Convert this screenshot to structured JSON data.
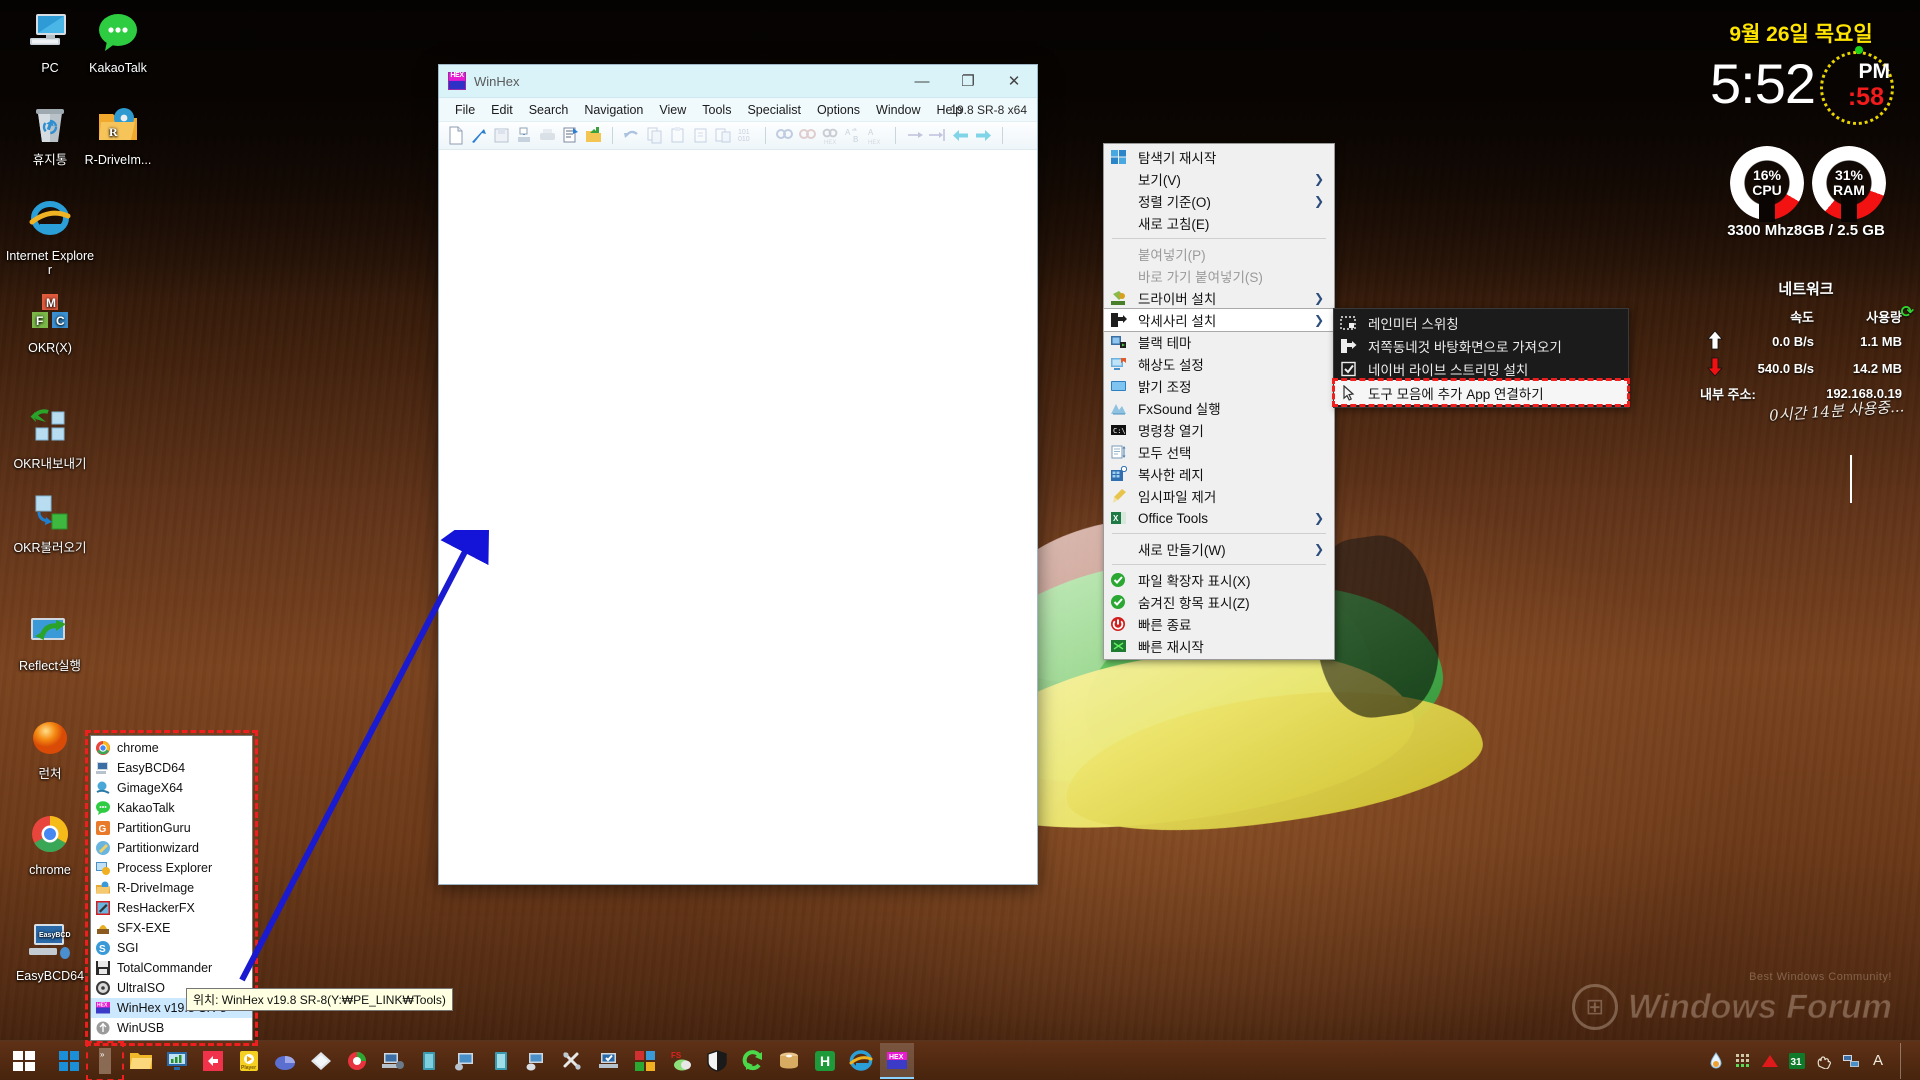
{
  "desktop": {
    "icons": [
      {
        "label": "PC",
        "icon": "computer-icon"
      },
      {
        "label": "KakaoTalk",
        "icon": "kakaotalk-icon"
      },
      {
        "label": "휴지통",
        "icon": "recycle-bin-icon"
      },
      {
        "label": "R-DriveIm...",
        "icon": "r-drive-image-icon"
      },
      {
        "label": "Internet Explorer",
        "icon": "internet-explorer-icon"
      },
      {
        "label": "OKR(X)",
        "icon": "okr-x-icon"
      },
      {
        "label": "OKR내보내기",
        "icon": "okr-export-icon"
      },
      {
        "label": "OKR불러오기",
        "icon": "okr-import-icon"
      },
      {
        "label": "Reflect실행",
        "icon": "reflect-run-icon"
      },
      {
        "label": "런처",
        "icon": "launcher-orb-icon"
      },
      {
        "label": "chrome",
        "icon": "chrome-icon"
      },
      {
        "label": "EasyBCD64",
        "icon": "easybcd-icon"
      }
    ]
  },
  "winhex": {
    "title": "WinHex",
    "app_icon": "winhex-icon",
    "version": "19.8 SR-8 x64",
    "window_buttons": {
      "minimize": "—",
      "maximize": "❐",
      "close": "✕"
    },
    "menus": [
      "File",
      "Edit",
      "Search",
      "Navigation",
      "View",
      "Tools",
      "Specialist",
      "Options",
      "Window",
      "Help"
    ],
    "toolbar_groups": [
      [
        "new-file-icon",
        "open-file-icon",
        "save-file-icon",
        "save-as-icon",
        "print-icon",
        "properties-icon",
        "open-folder-icon"
      ],
      [
        "undo-icon",
        "copy-icon",
        "paste-clipboard-icon",
        "paste-icon",
        "copy-block-icon",
        "binary-101-icon"
      ],
      [
        "find-icon",
        "find-hex-icon",
        "find-next-icon",
        "replace-text-icon",
        "replace-hex-icon"
      ],
      [
        "goto-icon",
        "goto-offset-icon",
        "back-icon",
        "forward-icon"
      ]
    ]
  },
  "context_menu": {
    "items": [
      {
        "label": "탐색기 재시작",
        "icon": "explorer-restart-icon",
        "arrow": false,
        "disabled": false,
        "selected": false
      },
      {
        "label": "보기(V)",
        "icon": "none",
        "arrow": true,
        "disabled": false,
        "selected": false
      },
      {
        "label": "정렬 기준(O)",
        "icon": "none",
        "arrow": true,
        "disabled": false,
        "selected": false
      },
      {
        "label": "새로 고침(E)",
        "icon": "none",
        "arrow": false,
        "disabled": false,
        "selected": false
      },
      {
        "separator": true
      },
      {
        "label": "붙여넣기(P)",
        "icon": "none",
        "arrow": false,
        "disabled": true,
        "selected": false
      },
      {
        "label": "바로 가기 붙여넣기(S)",
        "icon": "none",
        "arrow": false,
        "disabled": true,
        "selected": false
      },
      {
        "label": "드라이버 설치",
        "icon": "driver-install-icon",
        "arrow": true,
        "disabled": false,
        "selected": false
      },
      {
        "label": "악세사리 설치",
        "icon": "accessory-install-icon",
        "arrow": true,
        "disabled": false,
        "selected": true
      },
      {
        "label": "블랙      테마",
        "icon": "black-theme-icon",
        "arrow": false,
        "disabled": false,
        "selected": false
      },
      {
        "label": "해상도    설정",
        "icon": "resolution-icon",
        "arrow": false,
        "disabled": false,
        "selected": false
      },
      {
        "label": "밝기      조정",
        "icon": "brightness-icon",
        "arrow": false,
        "disabled": false,
        "selected": false
      },
      {
        "label": "FxSound 실행",
        "icon": "fxsound-icon",
        "arrow": false,
        "disabled": false,
        "selected": false
      },
      {
        "label": "명령창    열기",
        "icon": "command-prompt-icon",
        "arrow": false,
        "disabled": false,
        "selected": false
      },
      {
        "label": "모두      선택",
        "icon": "select-all-icon",
        "arrow": false,
        "disabled": false,
        "selected": false
      },
      {
        "label": "복사한    레지",
        "icon": "registry-copy-icon",
        "arrow": false,
        "disabled": false,
        "selected": false
      },
      {
        "label": "임시파일 제거",
        "icon": "temp-clean-icon",
        "arrow": false,
        "disabled": false,
        "selected": false
      },
      {
        "label": "Office    Tools",
        "icon": "office-tools-icon",
        "arrow": true,
        "disabled": false,
        "selected": false
      },
      {
        "separator": true
      },
      {
        "label": "새로 만들기(W)",
        "icon": "none",
        "arrow": true,
        "disabled": false,
        "selected": false
      },
      {
        "separator": true
      },
      {
        "label": "파일 확장자 표시(X)",
        "icon": "check-green-icon",
        "arrow": false,
        "disabled": false,
        "selected": false
      },
      {
        "label": "숨겨진 항목 표시(Z)",
        "icon": "check-green-icon",
        "arrow": false,
        "disabled": false,
        "selected": false
      },
      {
        "label": "빠른      종료",
        "icon": "shutdown-icon",
        "arrow": false,
        "disabled": false,
        "selected": false
      },
      {
        "label": "빠른 재시작",
        "icon": "restart-icon",
        "arrow": false,
        "disabled": false,
        "selected": false
      }
    ]
  },
  "submenu": {
    "items": [
      {
        "label": "레인미터 스위칭",
        "icon": "rainmeter-icon",
        "highlighted": false
      },
      {
        "label": "저쪽동네것 바탕화면으로 가져오기",
        "icon": "import-desktop-icon",
        "highlighted": false
      },
      {
        "label": "네이버 라이브 스트리밍 설치",
        "icon": "checkbox-checked-icon",
        "highlighted": false
      },
      {
        "label": "도구 모음에 추가 App 연결하기",
        "icon": "cursor-link-icon",
        "highlighted": true
      }
    ]
  },
  "launcher": {
    "items": [
      {
        "label": "chrome",
        "icon": "chrome-icon",
        "selected": false
      },
      {
        "label": "EasyBCD64",
        "icon": "easybcd-icon",
        "selected": false
      },
      {
        "label": "GimageX64",
        "icon": "gimagex-icon",
        "selected": false
      },
      {
        "label": "KakaoTalk",
        "icon": "kakaotalk-icon",
        "selected": false
      },
      {
        "label": "PartitionGuru",
        "icon": "partitionguru-icon",
        "selected": false
      },
      {
        "label": "Partitionwizard",
        "icon": "partitionwizard-icon",
        "selected": false
      },
      {
        "label": "Process Explorer",
        "icon": "process-explorer-icon",
        "selected": false
      },
      {
        "label": "R-DriveImage",
        "icon": "r-drive-image-icon",
        "selected": false
      },
      {
        "label": "ResHackerFX",
        "icon": "reshacker-icon",
        "selected": false
      },
      {
        "label": "SFX-EXE",
        "icon": "sfx-exe-icon",
        "selected": false
      },
      {
        "label": "SGI",
        "icon": "sgi-icon",
        "selected": false
      },
      {
        "label": "TotalCommander",
        "icon": "totalcommander-icon",
        "selected": false
      },
      {
        "label": "UltraISO",
        "icon": "ultraiso-icon",
        "selected": false
      },
      {
        "label": "WinHex v19.8 SR-8",
        "icon": "winhex-icon",
        "selected": true
      },
      {
        "label": "WinUSB",
        "icon": "winusb-icon",
        "selected": false
      }
    ]
  },
  "tooltip": {
    "text": "위치: WinHex v19.8 SR-8(Y:₩PE_LINK₩Tools)"
  },
  "widget": {
    "date": "9월 26일 목요일",
    "time": "5:52",
    "ampm": "PM",
    "seconds": ":58",
    "cpu": {
      "value": "16%",
      "label": "CPU",
      "percent": 16
    },
    "ram": {
      "value": "31%",
      "label": "RAM",
      "percent": 31
    },
    "specs": "3300 Mhz8GB /  2.5 GB",
    "network": {
      "title": "네트워크",
      "col_speed": "속도",
      "col_usage": "사용량",
      "upload_speed": "0.0 B/s",
      "upload_usage": "1.1 MB",
      "download_speed": "540.0 B/s",
      "download_usage": "14.2 MB",
      "ip_label": "내부 주소:",
      "ip_value": "192.168.0.19",
      "refresh_icon": "refresh-icon"
    },
    "uptime_note": "0시간 14분 사용중..."
  },
  "watermark": {
    "tagline": "Best Windows Community!",
    "title": "Windows Forum",
    "logo": "windows-logo-icon"
  },
  "taskbar": {
    "start_icon": "windows-start-icon",
    "items": [
      {
        "icon": "windows-blue-icon",
        "name": "windows-tile-button",
        "active": false,
        "quicklaunch": false
      },
      {
        "icon": "quicklaunch-chevron-icon",
        "name": "quick-launch-toggle",
        "active": false,
        "quicklaunch": true
      },
      {
        "icon": "file-explorer-icon",
        "name": "file-explorer-button",
        "active": false,
        "quicklaunch": false
      },
      {
        "icon": "monitor-chart-icon",
        "name": "system-monitor-button",
        "active": false,
        "quicklaunch": false
      },
      {
        "icon": "red-diamond-icon",
        "name": "media-app-button",
        "active": false,
        "quicklaunch": false
      },
      {
        "icon": "player-icon",
        "name": "potplayer-button",
        "active": false,
        "quicklaunch": false
      },
      {
        "icon": "partition-pie-icon",
        "name": "partition-tool-button",
        "active": false,
        "quicklaunch": false
      },
      {
        "icon": "floppy-save-icon",
        "name": "backup-tool-button",
        "active": false,
        "quicklaunch": false
      },
      {
        "icon": "green-shield-disc-icon",
        "name": "antivirus-button",
        "active": false,
        "quicklaunch": false
      },
      {
        "icon": "laptop-gear-icon",
        "name": "system-config-button",
        "active": false,
        "quicklaunch": false
      },
      {
        "icon": "teal-book-icon",
        "name": "notes-button",
        "active": false,
        "quicklaunch": false
      },
      {
        "icon": "monitor-tools-icon",
        "name": "remote-tool-button",
        "active": false,
        "quicklaunch": false
      },
      {
        "icon": "teal-book2-icon",
        "name": "docs-button",
        "active": false,
        "quicklaunch": false
      },
      {
        "icon": "monitor-audio-icon",
        "name": "audio-tool-button",
        "active": false,
        "quicklaunch": false
      },
      {
        "icon": "wrench-tools-icon",
        "name": "tools-button",
        "active": false,
        "quicklaunch": false
      },
      {
        "icon": "laptop-check-icon",
        "name": "driver-check-button",
        "active": false,
        "quicklaunch": false
      },
      {
        "icon": "color-squares-icon",
        "name": "theme-button",
        "active": false,
        "quicklaunch": false
      },
      {
        "icon": "fs-mouse-icon",
        "name": "fs-tool-button",
        "active": false,
        "quicklaunch": false
      },
      {
        "icon": "shield-white-icon",
        "name": "defender-button",
        "active": false,
        "quicklaunch": false
      },
      {
        "icon": "green-recycle-icon",
        "name": "refresh-tool-button",
        "active": false,
        "quicklaunch": false
      },
      {
        "icon": "disc-box-icon",
        "name": "iso-tool-button",
        "active": false,
        "quicklaunch": false
      },
      {
        "icon": "green-h-icon",
        "name": "hwmonitor-button",
        "active": false,
        "quicklaunch": false
      },
      {
        "icon": "internet-explorer-icon",
        "name": "ie-button",
        "active": false,
        "quicklaunch": false
      },
      {
        "icon": "winhex-icon",
        "name": "winhex-taskbar-button",
        "active": true,
        "quicklaunch": false
      }
    ],
    "tray": [
      {
        "icon": "flame-drop-icon",
        "name": "tray-temperature"
      },
      {
        "icon": "grid-icon",
        "name": "tray-grid"
      },
      {
        "icon": "red-triangle-icon",
        "name": "tray-alert"
      },
      {
        "icon": "calendar-31-icon",
        "name": "tray-calendar",
        "badge": "31"
      },
      {
        "icon": "hand-icon",
        "name": "tray-hand"
      },
      {
        "icon": "network-icon",
        "name": "tray-network"
      },
      {
        "icon": "ime-a-icon",
        "name": "tray-ime",
        "text": "A"
      }
    ]
  }
}
